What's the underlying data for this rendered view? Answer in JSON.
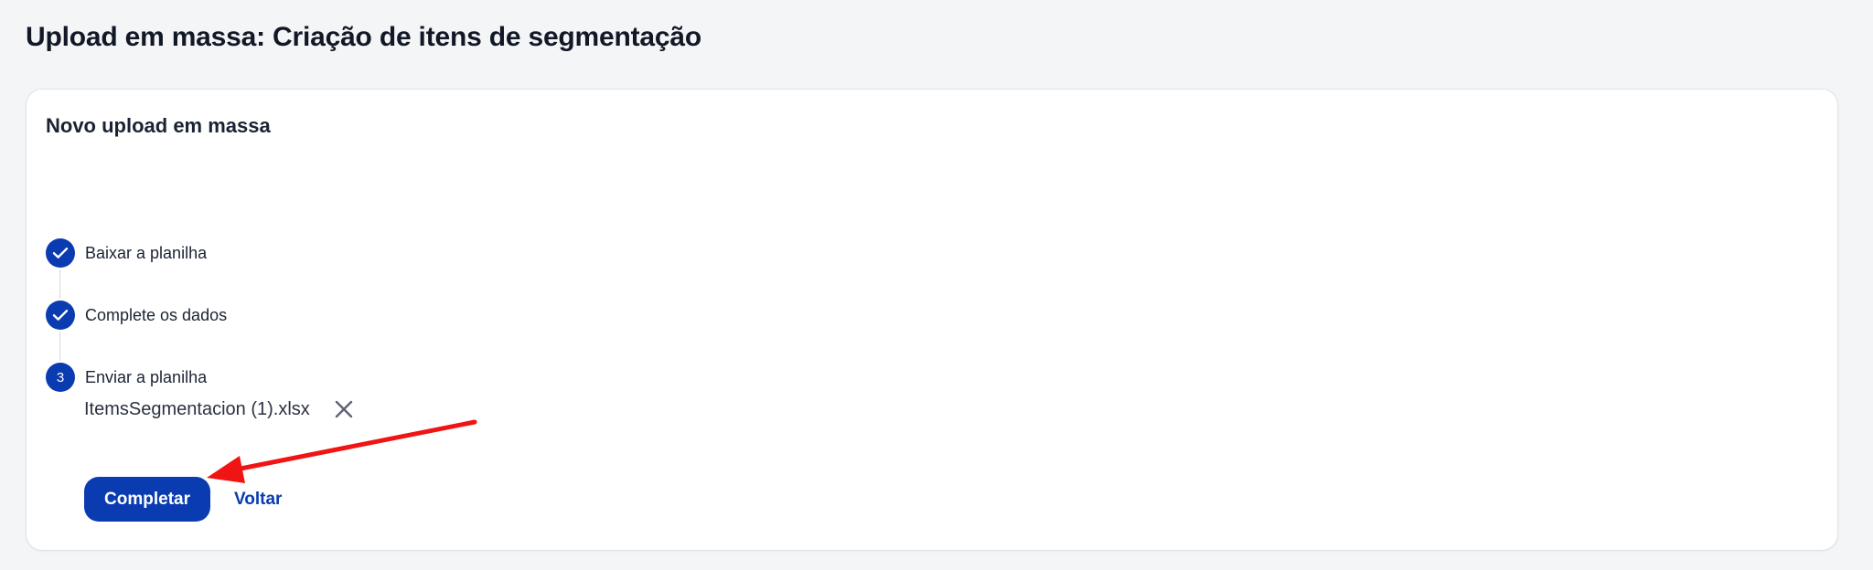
{
  "page": {
    "title": "Upload em massa: Criação de itens de segmentação"
  },
  "card": {
    "title": "Novo upload em massa"
  },
  "steps": [
    {
      "label": "Baixar a planilha",
      "status": "completed",
      "icon": "check-icon"
    },
    {
      "label": "Complete os dados",
      "status": "completed",
      "icon": "check-icon"
    },
    {
      "label": "Enviar a planilha",
      "status": "current",
      "number": "3"
    }
  ],
  "upload": {
    "file_name": "ItemsSegmentacion (1).xlsx",
    "remove_icon": "close-icon"
  },
  "actions": {
    "primary_label": "Completar",
    "secondary_label": "Voltar"
  },
  "colors": {
    "primary": "#0a3bb0",
    "annotation_arrow": "#f01414",
    "background": "#f4f5f7"
  }
}
